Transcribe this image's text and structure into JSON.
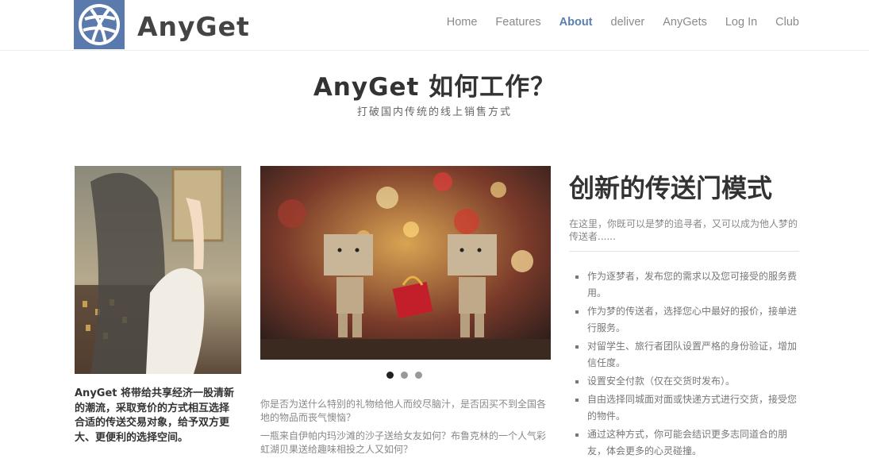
{
  "brand": {
    "name": "AnyGet"
  },
  "nav": [
    {
      "label": "Home",
      "active": false
    },
    {
      "label": "Features",
      "active": false
    },
    {
      "label": "About",
      "active": true
    },
    {
      "label": "deliver",
      "active": false
    },
    {
      "label": "AnyGets",
      "active": false
    },
    {
      "label": "Log In",
      "active": false
    },
    {
      "label": "Club",
      "active": false
    }
  ],
  "hero": {
    "title": "AnyGet 如何工作？",
    "subtitle": "打破国内传统的线上销售方式"
  },
  "left": {
    "text": "AnyGet 将带给共享经济一股清新的潮流，采取竞价的方式相互选择合适的传送交易对象，给予双方更大、更便利的选择空间。"
  },
  "slider": {
    "slides": 3,
    "active_index": 0,
    "paragraphs": [
      "你是否为送什么特别的礼物给他人而绞尽脑汁，是否因买不到全国各地的物品而丧气懊恼？",
      "一瓶来自伊帕内玛沙滩的沙子送给女友如何？布鲁克林的一个人气彩虹湖贝果送给趣味相投之人又如何？"
    ]
  },
  "right": {
    "title": "创新的传送门模式",
    "intro": "在这里，你既可以是梦的追寻者，又可以成为他人梦的传送者......",
    "features": [
      "作为逐梦者，发布您的需求以及您可接受的服务费用。",
      "作为梦的传送者，选择您心中最好的报价，接单进行服务。",
      "对留学生、旅行者团队设置严格的身份验证，增加信任度。",
      "设置安全付款（仅在交货时发布）。",
      "自由选择同城面对面或快递方式进行交货，接受您的物件。",
      "通过这种方式，你可能会结识更多志同道合的朋友，体会更多的心灵碰撞。"
    ]
  },
  "colors": {
    "accent": "#5a7fb0",
    "logo_bg": "#5a79ad"
  }
}
